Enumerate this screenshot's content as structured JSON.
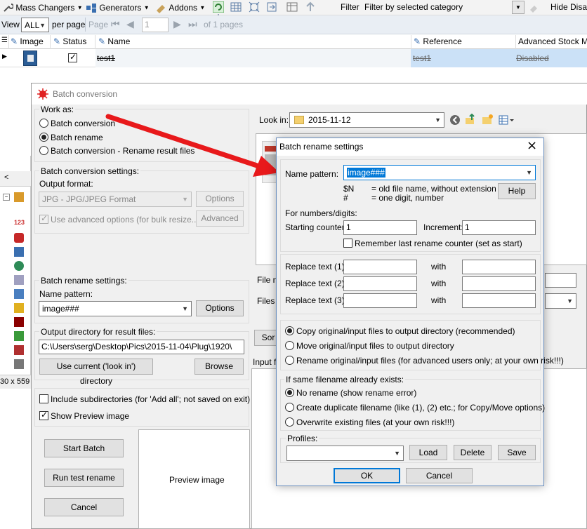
{
  "toolbar": {
    "mass_changers": "Mass Changers",
    "generators": "Generators",
    "addons": "Addons",
    "filter_label": "Filter",
    "filter_value": "Filter by selected category",
    "hide_disabled": "Hide Disab"
  },
  "pager": {
    "view_label": "View",
    "view_value": "ALL",
    "per_page": "per page",
    "page_label": "Page",
    "page_value": "1",
    "of_pages": "of 1 pages"
  },
  "grid": {
    "columns": [
      "Image",
      "Status",
      "Name",
      "Reference",
      "Advanced Stock Man"
    ],
    "row": {
      "name": "test1",
      "reference": "test1",
      "adv_stock": "Disabled"
    }
  },
  "side": {
    "dimensions": "30 x 559"
  },
  "batch": {
    "title": "Batch conversion",
    "work_as": "Work as:",
    "opt_conversion": "Batch conversion",
    "opt_rename": "Batch rename",
    "opt_conv_rename": "Batch conversion - Rename result files",
    "conv_settings": "Batch conversion settings:",
    "output_format": "Output format:",
    "format_value": "JPG - JPG/JPEG Format",
    "options_btn": "Options",
    "use_advanced": "Use advanced options (for bulk resize...)",
    "advanced_btn": "Advanced",
    "rename_settings": "Batch rename settings:",
    "name_pattern_label": "Name pattern:",
    "name_pattern_value": "image###",
    "options_btn2": "Options",
    "output_dir_label": "Output directory for result files:",
    "output_dir_value": "C:\\Users\\serg\\Desktop\\Pics\\2015-11-04\\Plug\\1920\\",
    "use_current_btn": "Use current ('look in') directory",
    "browse_btn": "Browse",
    "include_subdirs": "Include subdirectories (for 'Add all'; not saved on exit)",
    "show_preview": "Show Preview image",
    "start_btn": "Start Batch",
    "test_btn": "Run test rename",
    "cancel_btn": "Cancel",
    "preview_label": "Preview image",
    "look_in_label": "Look in:",
    "look_in_value": "2015-11-12",
    "file_name_label": "File na",
    "files_of_label": "Files o",
    "sort_btn": "Sor",
    "input_files_label": "Input fi"
  },
  "rename": {
    "title": "Batch rename settings",
    "name_pattern_label": "Name pattern:",
    "name_pattern_value": "image###",
    "hint1_key": "$N",
    "hint1_val": "= old file name, without extension",
    "hint2_key": "#",
    "hint2_val": "= one digit, number",
    "help_btn": "Help",
    "numbers_label": "For numbers/digits:",
    "start_counter_label": "Starting counter:",
    "start_counter_value": "1",
    "increment_label": "Increment:",
    "increment_value": "1",
    "remember_label": "Remember last rename counter (set as start)",
    "replace1": "Replace text (1):",
    "replace2": "Replace text (2):",
    "replace3": "Replace text (3):",
    "with": "with",
    "copy_opt": "Copy original/input files to output directory (recommended)",
    "move_opt": "Move original/input files to output directory",
    "rename_opt": "Rename original/input files (for advanced users only; at your own risk!!!)",
    "same_label": "If same filename already exists:",
    "no_rename": "No rename (show rename error)",
    "duplicate": "Create duplicate filename (like (1), (2) etc.; for Copy/Move options)",
    "overwrite": "Overwrite existing files (at your own risk!!!)",
    "profiles_label": "Profiles:",
    "load_btn": "Load",
    "delete_btn": "Delete",
    "save_btn": "Save",
    "ok_btn": "OK",
    "cancel_btn": "Cancel"
  },
  "colors": {
    "accent": "#0078d7",
    "arrow": "#e8191b",
    "row_highlight": "#cbe1f7"
  }
}
